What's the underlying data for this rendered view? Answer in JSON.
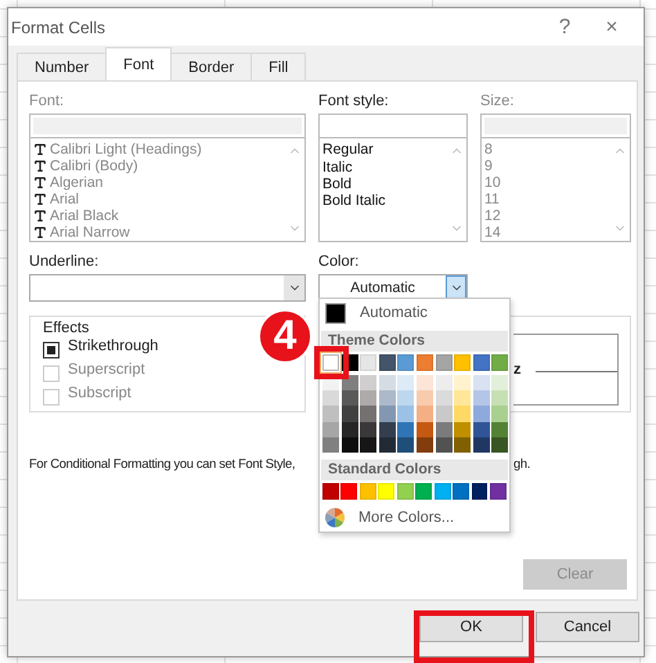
{
  "window": {
    "title": "Format Cells",
    "help": "?",
    "close": "×"
  },
  "tabs": [
    {
      "label": "Number",
      "selected": false
    },
    {
      "label": "Font",
      "selected": true
    },
    {
      "label": "Border",
      "selected": false
    },
    {
      "label": "Fill",
      "selected": false
    }
  ],
  "font": {
    "label": "Font:",
    "disabled": true,
    "items": [
      "Calibri Light (Headings)",
      "Calibri (Body)",
      "Algerian",
      "Arial",
      "Arial Black",
      "Arial Narrow"
    ]
  },
  "font_style": {
    "label": "Font style:",
    "disabled": false,
    "items": [
      "Regular",
      "Italic",
      "Bold",
      "Bold Italic"
    ]
  },
  "size": {
    "label": "Size:",
    "disabled": true,
    "items": [
      "8",
      "9",
      "10",
      "11",
      "12",
      "14"
    ]
  },
  "underline": {
    "label": "Underline:"
  },
  "color": {
    "label": "Color:",
    "value": "Automatic",
    "expanded": true
  },
  "effects": {
    "title": "Effects",
    "options": [
      {
        "label": "Strikethrough",
        "checked": true,
        "disabled": false
      },
      {
        "label": "Superscript",
        "checked": false,
        "disabled": true
      },
      {
        "label": "Subscript",
        "checked": false,
        "disabled": true
      }
    ]
  },
  "preview": {
    "text": "z"
  },
  "note": {
    "parts": [
      "For Conditional Formatting you can set Font Style,",
      "gh."
    ]
  },
  "clear_button": {
    "label": "Clear",
    "disabled": true
  },
  "buttons": [
    {
      "label": "OK"
    },
    {
      "label": "Cancel"
    }
  ],
  "color_menu": {
    "automatic": {
      "label": "Automatic",
      "color": "#000000"
    },
    "theme_title": "Theme Colors",
    "standard_title": "Standard Colors",
    "more": "More Colors...",
    "theme": [
      {
        "color": "#ffffff",
        "selected": true,
        "shades": [
          {
            "color": "#f2f2f2",
            "selected": false
          },
          {
            "color": "#d9d9d9",
            "selected": false
          },
          {
            "color": "#bfbfbf",
            "selected": false
          },
          {
            "color": "#a6a6a6",
            "selected": false
          },
          {
            "color": "#808080",
            "selected": false
          }
        ]
      },
      {
        "color": "#000000",
        "selected": false,
        "shades": [
          {
            "color": "#7f7f7f",
            "selected": false
          },
          {
            "color": "#595959",
            "selected": false
          },
          {
            "color": "#404040",
            "selected": false
          },
          {
            "color": "#262626",
            "selected": false
          },
          {
            "color": "#0d0d0d",
            "selected": false
          }
        ]
      },
      {
        "color": "#e7e6e6",
        "selected": false,
        "shades": [
          {
            "color": "#d0cece",
            "selected": false
          },
          {
            "color": "#aeaaaa",
            "selected": false
          },
          {
            "color": "#757171",
            "selected": false
          },
          {
            "color": "#3a3838",
            "selected": false
          },
          {
            "color": "#171616",
            "selected": false
          }
        ]
      },
      {
        "color": "#44546a",
        "selected": false,
        "shades": [
          {
            "color": "#d6dce4",
            "selected": false
          },
          {
            "color": "#acb9ca",
            "selected": false
          },
          {
            "color": "#8497b0",
            "selected": false
          },
          {
            "color": "#333f4f",
            "selected": false
          },
          {
            "color": "#222b35",
            "selected": false
          }
        ]
      },
      {
        "color": "#5b9bd5",
        "selected": false,
        "shades": [
          {
            "color": "#ddebf7",
            "selected": false
          },
          {
            "color": "#bdd7ee",
            "selected": false
          },
          {
            "color": "#9bc2e6",
            "selected": false
          },
          {
            "color": "#2f75b5",
            "selected": false
          },
          {
            "color": "#1f4e78",
            "selected": false
          }
        ]
      },
      {
        "color": "#ed7d31",
        "selected": false,
        "shades": [
          {
            "color": "#fce4d6",
            "selected": false
          },
          {
            "color": "#f8cbad",
            "selected": false
          },
          {
            "color": "#f4b084",
            "selected": false
          },
          {
            "color": "#c65911",
            "selected": false
          },
          {
            "color": "#833c0c",
            "selected": false
          }
        ]
      },
      {
        "color": "#a5a5a5",
        "selected": false,
        "shades": [
          {
            "color": "#ededed",
            "selected": false
          },
          {
            "color": "#dbdbdb",
            "selected": false
          },
          {
            "color": "#c9c9c9",
            "selected": false
          },
          {
            "color": "#7b7b7b",
            "selected": false
          },
          {
            "color": "#525252",
            "selected": false
          }
        ]
      },
      {
        "color": "#ffc000",
        "selected": false,
        "shades": [
          {
            "color": "#fff2cc",
            "selected": false
          },
          {
            "color": "#ffe699",
            "selected": false
          },
          {
            "color": "#ffd966",
            "selected": false
          },
          {
            "color": "#bf8f00",
            "selected": false
          },
          {
            "color": "#806000",
            "selected": false
          }
        ]
      },
      {
        "color": "#4472c4",
        "selected": false,
        "shades": [
          {
            "color": "#d9e1f2",
            "selected": false
          },
          {
            "color": "#b4c6e7",
            "selected": false
          },
          {
            "color": "#8ea9db",
            "selected": false
          },
          {
            "color": "#305496",
            "selected": false
          },
          {
            "color": "#203764",
            "selected": false
          }
        ]
      },
      {
        "color": "#70ad47",
        "selected": false,
        "shades": [
          {
            "color": "#e2efda",
            "selected": false
          },
          {
            "color": "#c6e0b4",
            "selected": false
          },
          {
            "color": "#a9d08e",
            "selected": false
          },
          {
            "color": "#548235",
            "selected": false
          },
          {
            "color": "#375623",
            "selected": false
          }
        ]
      }
    ],
    "standard": [
      {
        "color": "#c00000",
        "selected": false
      },
      {
        "color": "#ff0000",
        "selected": false
      },
      {
        "color": "#ffc000",
        "selected": false
      },
      {
        "color": "#ffff00",
        "selected": false
      },
      {
        "color": "#92d050",
        "selected": false
      },
      {
        "color": "#00b050",
        "selected": false
      },
      {
        "color": "#00b0f0",
        "selected": false
      },
      {
        "color": "#0070c0",
        "selected": false
      },
      {
        "color": "#002060",
        "selected": false
      },
      {
        "color": "#7030a0",
        "selected": false
      }
    ]
  },
  "annotations": {
    "step": "4"
  }
}
